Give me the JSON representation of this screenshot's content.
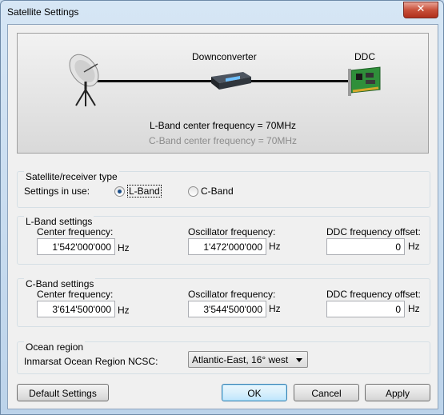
{
  "window": {
    "title": "Satellite Settings",
    "close_glyph": "✕"
  },
  "diagram": {
    "downconverter_label": "Downconverter",
    "ddc_label": "DDC",
    "lband_caption": "L-Band center frequency = 70MHz",
    "cband_caption": "C-Band center frequency = 70MHz"
  },
  "receiver_type": {
    "title": "Satellite/receiver type",
    "settings_in_use_label": "Settings in use:",
    "options": [
      {
        "label": "L-Band",
        "selected": true
      },
      {
        "label": "C-Band",
        "selected": false
      }
    ]
  },
  "lband": {
    "title": "L-Band settings",
    "center_frequency_label": "Center frequency:",
    "center_frequency": "1'542'000'000",
    "oscillator_frequency_label": "Oscillator frequency:",
    "oscillator_frequency": "1'472'000'000",
    "ddc_offset_label": "DDC frequency offset:",
    "ddc_offset": "0",
    "unit": "Hz"
  },
  "cband": {
    "title": "C-Band settings",
    "center_frequency_label": "Center frequency:",
    "center_frequency": "3'614'500'000",
    "oscillator_frequency_label": "Oscillator frequency:",
    "oscillator_frequency": "3'544'500'000",
    "ddc_offset_label": "DDC frequency offset:",
    "ddc_offset": "0",
    "unit": "Hz"
  },
  "ocean": {
    "title": "Ocean region",
    "label": "Inmarsat Ocean Region NCSC:",
    "selected": "Atlantic-East, 16° west"
  },
  "buttons": {
    "default_settings": "Default Settings",
    "ok": "OK",
    "cancel": "Cancel",
    "apply": "Apply"
  },
  "colors": {
    "title_bar": "#c9dcef",
    "close_button": "#c8503a",
    "caption_disabled": "#8c8c8c",
    "group_border": "#d5dfe5",
    "radio_dot": "#1b4f8a"
  }
}
